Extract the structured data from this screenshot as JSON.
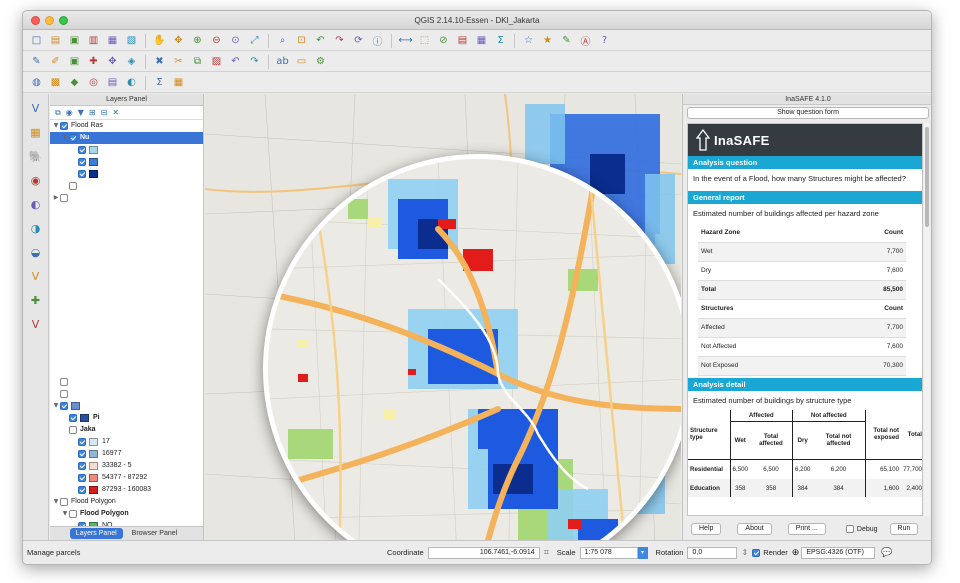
{
  "window": {
    "title": "QGIS 2.14.10-Essen - DKI_Jakarta"
  },
  "toolbar_icons": {
    "row1": [
      "new-project-icon",
      "open-project-icon",
      "save-project-icon",
      "save-as-icon",
      "print-composer-icon",
      "composer-manager-icon",
      "pan-icon",
      "pan-to-selection-icon",
      "zoom-in-icon",
      "zoom-out-icon",
      "zoom-actual-icon",
      "zoom-full-icon",
      "zoom-to-selection-icon",
      "zoom-to-layer-icon",
      "zoom-last-icon",
      "zoom-next-icon",
      "refresh-icon",
      "identify-icon",
      "measure-icon",
      "select-icon",
      "deselect-icon",
      "attribute-table-icon",
      "field-calculator-icon",
      "statistics-icon",
      "new-bookmark-icon",
      "show-bookmarks-icon",
      "annotation-icon",
      "label-icon",
      "help-icon"
    ],
    "row2": [
      "current-edits-icon",
      "toggle-editing-icon",
      "save-edits-icon",
      "add-feature-icon",
      "move-feature-icon",
      "node-tool-icon",
      "delete-selected-icon",
      "cut-features-icon",
      "copy-features-icon",
      "paste-features-icon",
      "undo-icon",
      "redo-icon",
      "label-tool-icon",
      "csw-icon",
      "python-console-icon"
    ],
    "row3": [
      "globe-icon",
      "add-raster-icon",
      "add-vector-icon",
      "add-db-icon",
      "add-delimited-icon",
      "wms-icon",
      "sum-icon",
      "print-icon"
    ]
  },
  "left_tools": [
    "add-vector-layer-icon",
    "add-raster-layer-icon",
    "add-postgis-icon",
    "add-spatialite-icon",
    "add-wms-icon",
    "add-wcs-icon",
    "add-wfs-icon",
    "add-virtual-layer-icon",
    "new-shapefile-icon",
    "add-delimited-text-icon"
  ],
  "layers_panel": {
    "title": "Layers Panel",
    "tabs": [
      "Layers Panel",
      "Browser Panel"
    ],
    "rows": [
      {
        "indent": 0,
        "arrow": "▼",
        "checked": true,
        "label": "Flood Ras",
        "bold": false,
        "selected": false
      },
      {
        "indent": 1,
        "arrow": "▼",
        "checked": true,
        "label": "Nu",
        "bold": true,
        "selected": true
      },
      {
        "indent": 2,
        "arrow": "",
        "checked": true,
        "label": "",
        "swatch": "#a8d8ef"
      },
      {
        "indent": 2,
        "arrow": "",
        "checked": true,
        "label": "",
        "swatch": "#3b7fd8"
      },
      {
        "indent": 2,
        "arrow": "",
        "checked": true,
        "label": "",
        "swatch": "#0a2d8f"
      },
      {
        "indent": 1,
        "arrow": "",
        "checked": false,
        "label": ""
      },
      {
        "indent": 0,
        "arrow": "▶",
        "checked": false,
        "label": ""
      }
    ],
    "rows_bottom": [
      {
        "indent": 0,
        "arrow": "",
        "checked": false,
        "label": ""
      },
      {
        "indent": 0,
        "arrow": "",
        "checked": false,
        "label": ""
      },
      {
        "indent": 0,
        "arrow": "▼",
        "checked": true,
        "label": "",
        "swatch": "#6a8fd0"
      },
      {
        "indent": 1,
        "arrow": "",
        "checked": true,
        "label": "Pi",
        "bold": true,
        "swatch": "#2c4f9c"
      },
      {
        "indent": 1,
        "arrow": "",
        "checked": false,
        "label": "Jaka",
        "bold": true
      },
      {
        "indent": 2,
        "arrow": "",
        "checked": true,
        "label": "17",
        "swatch": "#d6e6f4"
      },
      {
        "indent": 2,
        "arrow": "",
        "checked": true,
        "label": "16977",
        "swatch": "#8fb6d9"
      },
      {
        "indent": 2,
        "arrow": "",
        "checked": true,
        "label": "33382 - 5",
        "swatch": "#f3dcd2"
      },
      {
        "indent": 2,
        "arrow": "",
        "checked": true,
        "label": "54377 - 87292",
        "swatch": "#f08a78"
      },
      {
        "indent": 2,
        "arrow": "",
        "checked": true,
        "label": "87293 - 160083",
        "swatch": "#d41d1d"
      },
      {
        "indent": 0,
        "arrow": "▼",
        "checked": false,
        "label": "Flood Polygon",
        "bold": false
      },
      {
        "indent": 1,
        "arrow": "▼",
        "checked": false,
        "label": "Flood Polygon",
        "bold": true
      },
      {
        "indent": 2,
        "arrow": "",
        "checked": true,
        "label": "NO",
        "swatch": "#4dbb63"
      },
      {
        "indent": 2,
        "arrow": "",
        "checked": true,
        "label": "YES",
        "swatch": "#3b7fd8"
      },
      {
        "indent": 0,
        "arrow": "▶",
        "checked": false,
        "label": "Population",
        "bold": true
      }
    ]
  },
  "inasafe": {
    "panel_title": "InaSAFE 4.1.0",
    "question_form_button": "Show question form",
    "logo_text": "InaSAFE",
    "analysis_question_heading": "Analysis question",
    "analysis_question": "In the event of a Flood, how many Structures might be affected?",
    "general_report_heading": "General report",
    "general_report_text": "Estimated number of buildings affected per hazard zone",
    "hazard_table": {
      "header": [
        "Hazard Zone",
        "Count"
      ],
      "rows": [
        [
          "Wet",
          "7,700"
        ],
        [
          "Dry",
          "7,600"
        ],
        [
          "Total",
          "85,500"
        ]
      ]
    },
    "structure_table": {
      "header": [
        "Structures",
        "Count"
      ],
      "rows": [
        [
          "Affected",
          "7,700"
        ],
        [
          "Not Affected",
          "7,600"
        ],
        [
          "Not Exposed",
          "70,300"
        ]
      ]
    },
    "analysis_detail_heading": "Analysis detail",
    "analysis_detail_text": "Estimated number of buildings by structure type",
    "detail_table": {
      "col_structure_type": "Structure type",
      "col_affected": "Affected",
      "col_not_affected": "Not affected",
      "col_total_not_exposed": "Total not exposed",
      "col_total": "Total",
      "sub_wet": "Wet",
      "sub_total_affected": "Total affected",
      "sub_dry": "Dry",
      "sub_total_not_affected": "Total not affected",
      "rows": [
        [
          "Residential",
          "6,500",
          "6,500",
          "6,200",
          "6,200",
          "65,100",
          "77,700"
        ],
        [
          "Education",
          "358",
          "358",
          "384",
          "384",
          "1,600",
          "2,400"
        ]
      ]
    },
    "buttons": {
      "help": "Help",
      "about": "About",
      "print": "Print ...",
      "debug": "Debug",
      "run": "Run"
    }
  },
  "statusbar": {
    "message": "Manage parcels",
    "coordinate_label": "Coordinate",
    "coordinate_value": "106.7461,-6.0914",
    "scale_label": "Scale",
    "scale_value": "1:75 078",
    "rotation_label": "Rotation",
    "rotation_value": "0,0",
    "render_label": "Render",
    "crs": "EPSG:4326 (OTF)"
  }
}
